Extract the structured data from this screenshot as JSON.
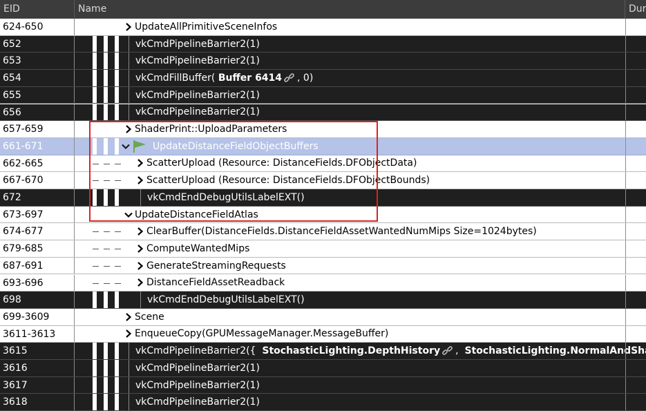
{
  "header": {
    "eid": "EID",
    "name": "Name",
    "duration": "Dur"
  },
  "colors": {
    "selection": "#b6c3e8",
    "highlight_box": "#e02020",
    "dark_row": "#1f1f1f",
    "flag": "#6aa84f"
  },
  "rows": [
    {
      "eid": "624-650",
      "style": "light",
      "indent": 0,
      "expander": "collapsed",
      "parts": [
        {
          "t": "UpdateAllPrimitiveSceneInfos"
        }
      ]
    },
    {
      "eid": "652",
      "style": "dark",
      "indent": 0,
      "expander": "none",
      "parts": [
        {
          "t": "vkCmdPipelineBarrier2(1)"
        }
      ]
    },
    {
      "eid": "653",
      "style": "dark",
      "indent": 0,
      "expander": "none",
      "parts": [
        {
          "t": "vkCmdPipelineBarrier2(1)"
        }
      ]
    },
    {
      "eid": "654",
      "style": "dark",
      "indent": 0,
      "expander": "none",
      "parts": [
        {
          "t": "vkCmdFillBuffer( "
        },
        {
          "t": "Buffer 6414",
          "bold": true
        },
        {
          "icon": "link-icon"
        },
        {
          "t": ", 0)"
        }
      ]
    },
    {
      "eid": "655",
      "style": "dark",
      "indent": 0,
      "expander": "none",
      "parts": [
        {
          "t": "vkCmdPipelineBarrier2(1)"
        }
      ]
    },
    {
      "eid": "656",
      "style": "dark",
      "indent": 0,
      "expander": "none",
      "parts": [
        {
          "t": "vkCmdPipelineBarrier2(1)"
        }
      ]
    },
    {
      "eid": "657-659",
      "style": "light",
      "indent": 0,
      "expander": "collapsed",
      "parts": [
        {
          "t": "ShaderPrint::UploadParameters"
        }
      ]
    },
    {
      "eid": "661-671",
      "style": "sel",
      "indent": 0,
      "expander": "expanded",
      "flag": true,
      "parts": [
        {
          "t": "UpdateDistanceFieldObjectBuffers"
        }
      ]
    },
    {
      "eid": "662-665",
      "style": "light",
      "indent": 1,
      "expander": "collapsed",
      "parts": [
        {
          "t": "ScatterUpload (Resource: DistanceFields.DFObjectData)"
        }
      ]
    },
    {
      "eid": "667-670",
      "style": "light",
      "indent": 1,
      "expander": "collapsed",
      "parts": [
        {
          "t": "ScatterUpload (Resource: DistanceFields.DFObjectBounds)"
        }
      ]
    },
    {
      "eid": "672",
      "style": "dark",
      "indent": 1,
      "expander": "none",
      "parts": [
        {
          "t": "vkCmdEndDebugUtilsLabelEXT()"
        }
      ]
    },
    {
      "eid": "673-697",
      "style": "light",
      "indent": 0,
      "expander": "expanded",
      "parts": [
        {
          "t": "UpdateDistanceFieldAtlas"
        }
      ]
    },
    {
      "eid": "674-677",
      "style": "light",
      "indent": 1,
      "expander": "collapsed",
      "parts": [
        {
          "t": "ClearBuffer(DistanceFields.DistanceFieldAssetWantedNumMips Size=1024bytes)"
        }
      ]
    },
    {
      "eid": "679-685",
      "style": "light",
      "indent": 1,
      "expander": "collapsed",
      "parts": [
        {
          "t": "ComputeWantedMips"
        }
      ]
    },
    {
      "eid": "687-691",
      "style": "light",
      "indent": 1,
      "expander": "collapsed",
      "parts": [
        {
          "t": "GenerateStreamingRequests"
        }
      ]
    },
    {
      "eid": "693-696",
      "style": "light",
      "indent": 1,
      "expander": "collapsed",
      "parts": [
        {
          "t": "DistanceFieldAssetReadback"
        }
      ]
    },
    {
      "eid": "698",
      "style": "dark",
      "indent": 1,
      "expander": "none",
      "parts": [
        {
          "t": "vkCmdEndDebugUtilsLabelEXT()"
        }
      ]
    },
    {
      "eid": "699-3609",
      "style": "light",
      "indent": 0,
      "expander": "collapsed",
      "parts": [
        {
          "t": "Scene"
        }
      ]
    },
    {
      "eid": "3611-3613",
      "style": "light",
      "indent": 0,
      "expander": "collapsed",
      "parts": [
        {
          "t": "EnqueueCopy(GPUMessageManager.MessageBuffer)"
        }
      ]
    },
    {
      "eid": "3615",
      "style": "dark",
      "indent": 0,
      "expander": "none",
      "parts": [
        {
          "t": "vkCmdPipelineBarrier2({  "
        },
        {
          "t": "StochasticLighting.DepthHistory",
          "bold": true
        },
        {
          "icon": "link-icon"
        },
        {
          "t": ",  "
        },
        {
          "t": "StochasticLighting.NormalAndSha",
          "bold": true
        }
      ]
    },
    {
      "eid": "3616",
      "style": "dark",
      "indent": 0,
      "expander": "none",
      "parts": [
        {
          "t": "vkCmdPipelineBarrier2(1)"
        }
      ]
    },
    {
      "eid": "3617",
      "style": "dark",
      "indent": 0,
      "expander": "none",
      "parts": [
        {
          "t": "vkCmdPipelineBarrier2(1)"
        }
      ]
    },
    {
      "eid": "3618",
      "style": "dark",
      "indent": 0,
      "expander": "none",
      "parts": [
        {
          "t": "vkCmdPipelineBarrier2(1)"
        }
      ]
    }
  ]
}
